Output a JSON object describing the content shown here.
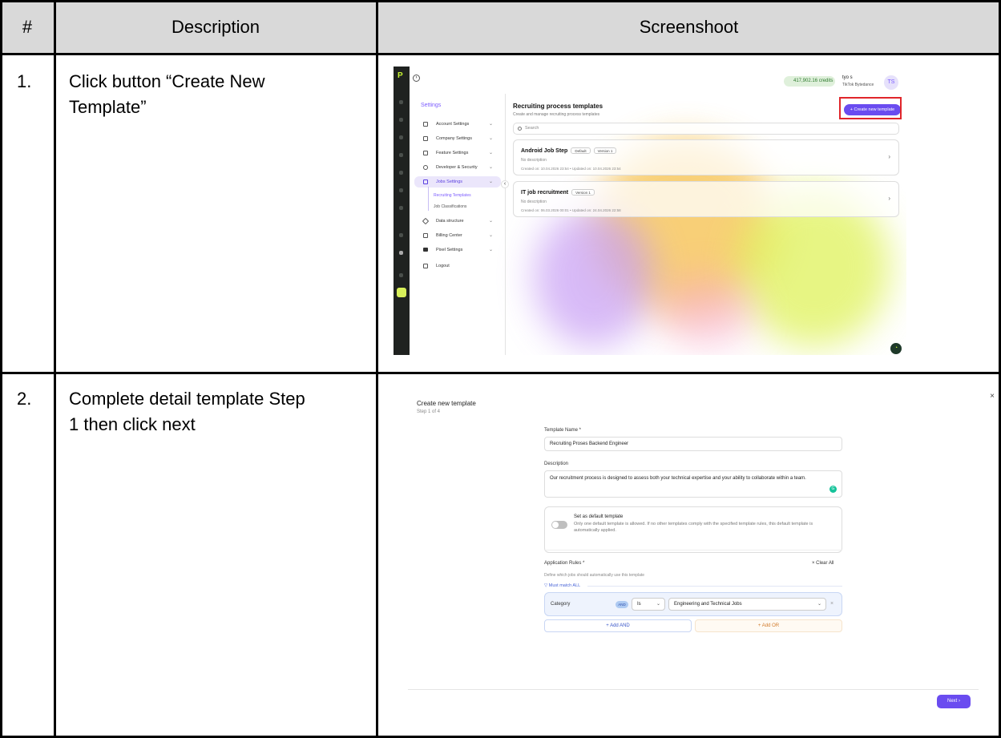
{
  "table": {
    "headers": [
      "#",
      "Description",
      "Screenshoot"
    ],
    "rows": [
      {
        "number": "1.",
        "description_line1": "Click button “Create New",
        "description_line2": "Template”"
      },
      {
        "number": "2.",
        "description_line1": "Complete detail template Step",
        "description_line2": "1 then click next"
      }
    ]
  },
  "shot1": {
    "logo_glyph": "P",
    "credits": "417,902.16 credits",
    "user_name": "tyo s",
    "user_company": "TikTok Bytedance",
    "avatar_initials": "TS",
    "settings_title": "Settings",
    "nav": [
      "Account Settings",
      "Company Settings",
      "Feature Settings",
      "Developer & Security",
      "Jobs Settings",
      "Data structure",
      "Billing Center",
      "Pixel Settings",
      "Logout"
    ],
    "subnav": [
      "Recruiting Templates",
      "Job Classifications"
    ],
    "page_title": "Recruiting process templates",
    "page_subtitle": "Create and manage recruiting process templates",
    "create_button": "+   Create new template",
    "search_placeholder": "Search",
    "cards": [
      {
        "title": "Android Job Step",
        "tags": [
          "Default",
          "Version 1"
        ],
        "description": "No description",
        "dates": "Created on: 10.04.2026 23:54   •   Updated on: 10.04.2026 23:54"
      },
      {
        "title": "IT job recruitment",
        "tags": [
          "Version 1"
        ],
        "description": "No description",
        "dates": "Created on: 06.03.2026 00:01   •   Updated on: 24.04.2026 22:58"
      }
    ],
    "colors": {
      "accent": "#6a4cf0",
      "highlight": "#e0262b",
      "sidebar": "#1f2220"
    }
  },
  "shot2": {
    "title": "Create new template",
    "step": "Step 1 of 4",
    "template_name_label": "Template Name *",
    "template_name_value": "Recruiting Proses Backend Engineer",
    "description_label": "Description",
    "description_value": "Our recruitment process is designed to assess both your technical expertise and your ability to collaborate within a team.",
    "default_title": "Set as default template",
    "default_desc": "Only one default template is allowed. If no other templates comply with the specified template rules, this default template is automatically applied.",
    "rules_title": "Application Rules *",
    "clear_all": "×  Clear All",
    "rules_sub": "Define which jobs should automatically use this template",
    "must_match": "Must match ALL",
    "rule": {
      "field": "Category",
      "joiner": "AND",
      "operator": "Is",
      "value": "Engineering and Technical Jobs"
    },
    "add_and": "+  Add AND",
    "add_or": "+  Add OR",
    "next": "Next  ›",
    "close": "×"
  }
}
